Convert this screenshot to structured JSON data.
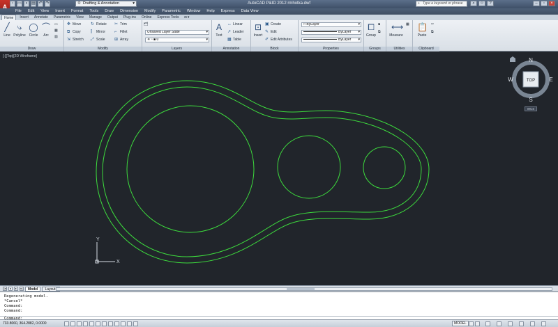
{
  "titlebar": {
    "workspace": "Drafting & Annotation",
    "app_title": "AutoCAD P&ID 2012   rmhotka.dwf",
    "search_placeholder": "Type a keyword or phrase"
  },
  "menubar": [
    "File",
    "Edit",
    "View",
    "Insert",
    "Format",
    "Tools",
    "Draw",
    "Dimension",
    "Modify",
    "Parametric",
    "Window",
    "Help",
    "Express",
    "Data View"
  ],
  "tabs": [
    "Home",
    "Insert",
    "Annotate",
    "Parametric",
    "View",
    "Manage",
    "Output",
    "Plug-ins",
    "Online",
    "Express Tools"
  ],
  "active_tab": "Home",
  "ribbon": {
    "draw": {
      "title": "Draw",
      "line": "Line",
      "polyline": "Polyline",
      "circle": "Circle",
      "arc": "Arc"
    },
    "modify": {
      "title": "Modify",
      "move": "Move",
      "rotate": "Rotate",
      "trim": "Trim",
      "copy": "Copy",
      "mirror": "Mirror",
      "fillet": "Fillet",
      "stretch": "Stretch",
      "scale": "Scale",
      "array": "Array"
    },
    "layers": {
      "title": "Layers",
      "layer_state": "Unsaved Layer State",
      "current_layer": "0"
    },
    "annotation": {
      "title": "Annotation",
      "text": "Text",
      "linear": "Linear",
      "leader": "Leader",
      "table": "Table"
    },
    "block": {
      "title": "Block",
      "insert": "Insert",
      "create": "Create",
      "edit": "Edit",
      "edit_attributes": "Edit Attributes"
    },
    "properties": {
      "title": "Properties",
      "color": "ByLayer",
      "linetype": "ByLayer",
      "lineweight": "ByLayer"
    },
    "groups": {
      "title": "Groups",
      "group": "Group"
    },
    "utilities": {
      "title": "Utilities",
      "measure": "Measure"
    },
    "clipboard": {
      "title": "Clipboard",
      "paste": "Paste"
    }
  },
  "viewport": {
    "label": "[-][Top][2D Wireframe]",
    "viewcube": {
      "n": "N",
      "s": "S",
      "e": "E",
      "w": "W",
      "face": "TOP"
    },
    "wcs": "WCS",
    "ucs_x": "X",
    "ucs_y": "Y"
  },
  "layout_tabs": [
    "Model",
    "Layout1"
  ],
  "command": {
    "history": [
      "Regenerating model.",
      "*Cancel*",
      "Command:",
      "Command:"
    ],
    "prompt": "Command:"
  },
  "status": {
    "coords": "733.8060, 364.2882, 0.0000",
    "model": "MODEL"
  },
  "colors": {
    "geometry": "#3ddc3d",
    "background": "#21252b"
  }
}
